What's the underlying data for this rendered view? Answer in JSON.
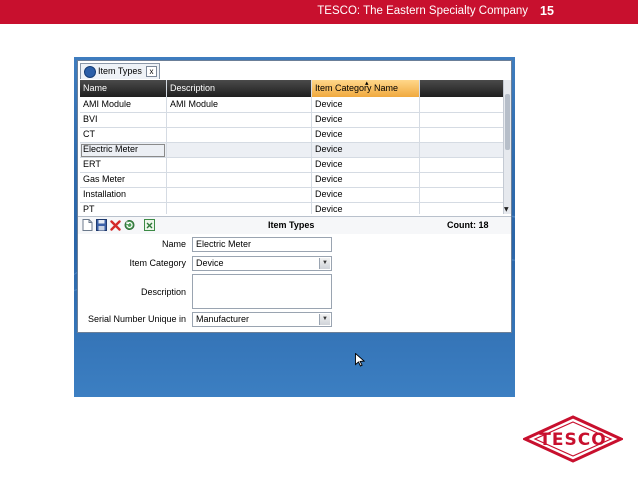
{
  "slide": {
    "company": "TESCO: The Eastern Specialty Company",
    "page_number": "15",
    "brand_color": "#c8102e",
    "logo_text": "TESCO"
  },
  "tab": {
    "label": "Item Types",
    "close": "x",
    "icon": "item-types-icon"
  },
  "grid": {
    "columns": [
      "Name",
      "Description",
      "Item Category Name"
    ],
    "sorted_column": "Item Category Name",
    "rows": [
      {
        "name": "AMI Module",
        "description": "AMI Module",
        "category": "Device"
      },
      {
        "name": "BVI",
        "description": "",
        "category": "Device"
      },
      {
        "name": "CT",
        "description": "",
        "category": "Device"
      },
      {
        "name": "Electric Meter",
        "description": "",
        "category": "Device"
      },
      {
        "name": "ERT",
        "description": "",
        "category": "Device"
      },
      {
        "name": "Gas Meter",
        "description": "",
        "category": "Device"
      },
      {
        "name": "Installation",
        "description": "",
        "category": "Device"
      },
      {
        "name": "PT",
        "description": "",
        "category": "Device"
      }
    ],
    "selected_row": "Electric Meter"
  },
  "toolbar": {
    "title": "Item Types",
    "count": "Count: 18",
    "icons": [
      "new-icon",
      "save-icon",
      "delete-icon",
      "refresh-icon",
      "export-icon"
    ]
  },
  "form": {
    "name_label": "Name",
    "name_value": "Electric Meter",
    "category_label": "Item Category",
    "category_value": "Device",
    "description_label": "Description",
    "description_value": "",
    "serial_label": "Serial Number Unique in",
    "serial_value": "Manufacturer"
  }
}
